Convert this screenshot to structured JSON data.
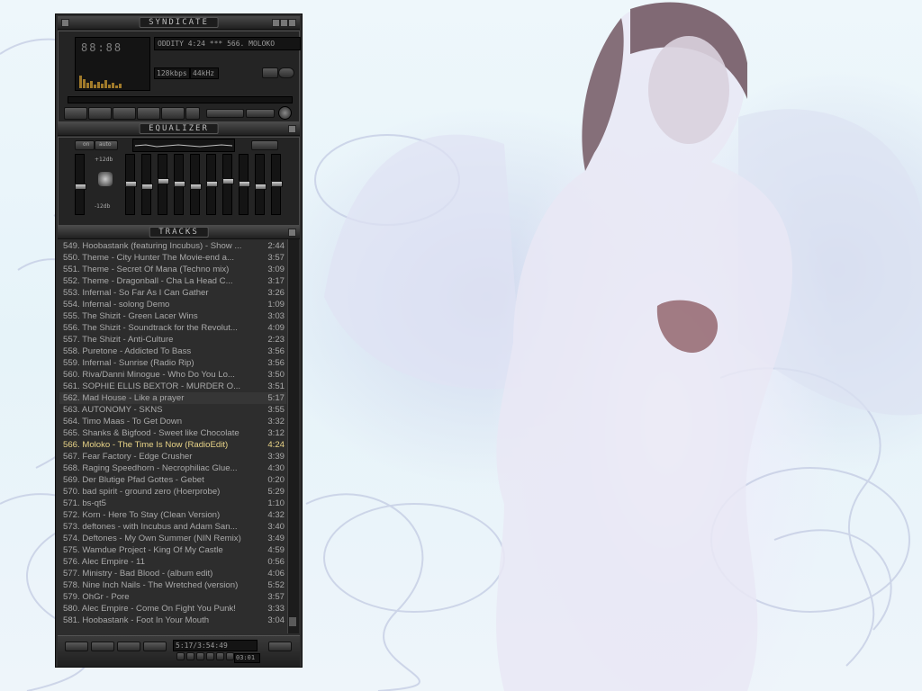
{
  "main_window": {
    "title": "SYNDICATE",
    "time_display": "88:88",
    "song_info": "ODDITY 4:24 *** 566. MOLOKO",
    "bitrate": "128kbps",
    "samplerate": "44kHz"
  },
  "equalizer": {
    "title": "EQUALIZER",
    "on_label": "on",
    "auto_label": "auto",
    "max_label": "+12db",
    "min_label": "-12db",
    "preamp_level": 0.45,
    "band_levels": [
      0.5,
      0.45,
      0.55,
      0.5,
      0.45,
      0.5,
      0.55,
      0.5,
      0.45,
      0.5
    ]
  },
  "playlist": {
    "title": "TRACKS",
    "tracks": [
      {
        "name": "549. Hoobastank (featuring Incubus) - Show ...",
        "time": "2:44"
      },
      {
        "name": "550. Theme - City Hunter The Movie-end a...",
        "time": "3:57"
      },
      {
        "name": "551. Theme - Secret Of Mana (Techno mix)",
        "time": "3:09"
      },
      {
        "name": "552. Theme - Dragonball - Cha La Head C...",
        "time": "3:17"
      },
      {
        "name": "553. Infernal - So Far As I Can Gather",
        "time": "3:26"
      },
      {
        "name": "554. Infernal - solong Demo",
        "time": "1:09"
      },
      {
        "name": "555. The Shizit - Green Lacer Wins",
        "time": "3:03"
      },
      {
        "name": "556. The Shizit - Soundtrack for the Revolut...",
        "time": "4:09"
      },
      {
        "name": "557. The Shizit - Anti-Culture",
        "time": "2:23"
      },
      {
        "name": "558. Puretone - Addicted To Bass",
        "time": "3:56"
      },
      {
        "name": "559. Infernal - Sunrise (Radio Rip)",
        "time": "3:56"
      },
      {
        "name": "560. Riva/Danni Minogue - Who Do You Lo...",
        "time": "3:50"
      },
      {
        "name": "561. SOPHIE ELLIS BEXTOR - MURDER O...",
        "time": "3:51"
      },
      {
        "name": "562. Mad House - Like a prayer",
        "time": "5:17"
      },
      {
        "name": "563. AUTONOMY - SKNS",
        "time": "3:55"
      },
      {
        "name": "564. Timo Maas - To Get Down",
        "time": "3:32"
      },
      {
        "name": "565. Shanks & Bigfood - Sweet like Chocolate",
        "time": "3:12"
      },
      {
        "name": "566. Moloko - The Time Is Now (RadioEdit)",
        "time": "4:24"
      },
      {
        "name": "567. Fear Factory - Edge Crusher",
        "time": "3:39"
      },
      {
        "name": "568. Raging Speedhorn - Necrophiliac Glue...",
        "time": "4:30"
      },
      {
        "name": "569. Der Blutige Pfad Gottes - Gebet",
        "time": "0:20"
      },
      {
        "name": "570. bad spirit - ground zero (Hoerprobe)",
        "time": "5:29"
      },
      {
        "name": "571. bs-qt5",
        "time": "1:10"
      },
      {
        "name": "572. Korn - Here To Stay (Clean Version)",
        "time": "4:32"
      },
      {
        "name": "573. deftones - with Incubus and Adam San...",
        "time": "3:40"
      },
      {
        "name": "574. Deftones - My Own Summer (NIN Remix)",
        "time": "3:49"
      },
      {
        "name": "575. Wamdue Project - King Of My Castle",
        "time": "4:59"
      },
      {
        "name": "576. Alec Empire - 11",
        "time": "0:56"
      },
      {
        "name": "577. Ministry - Bad Blood - (album edit)",
        "time": "4:06"
      },
      {
        "name": "578. Nine Inch Nails - The Wretched (version)",
        "time": "5:52"
      },
      {
        "name": "579. OhGr - Pore",
        "time": "3:57"
      },
      {
        "name": "580. Alec Empire - Come On Fight You Punk!",
        "time": "3:33"
      },
      {
        "name": "581. Hoobastank - Foot In Your Mouth",
        "time": "3:04"
      }
    ],
    "total_time": "5:17/3:54:49",
    "current_time": "03:01"
  },
  "colors": {
    "current_track": "#e9d488",
    "track_text": "#a9a9a9",
    "player_bg": "#2d2d2d"
  }
}
